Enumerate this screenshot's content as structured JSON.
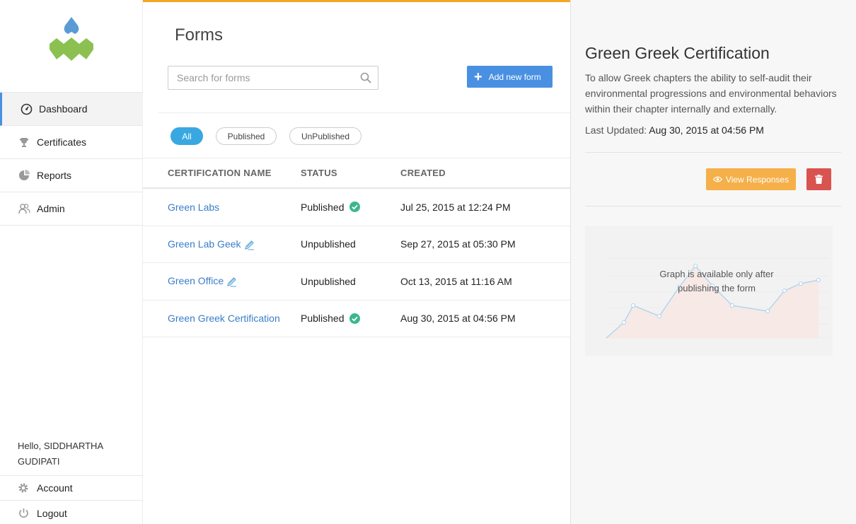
{
  "sidebar": {
    "nav": [
      {
        "label": "Dashboard",
        "icon": "dashboard-icon",
        "active": true
      },
      {
        "label": "Certificates",
        "icon": "trophy-icon",
        "active": false
      },
      {
        "label": "Reports",
        "icon": "pie-chart-icon",
        "active": false
      },
      {
        "label": "Admin",
        "icon": "users-icon",
        "active": false
      }
    ],
    "greeting": "Hello, SIDDHARTHA GUDIPATI",
    "bottom": [
      {
        "label": "Account",
        "icon": "gear-icon"
      },
      {
        "label": "Logout",
        "icon": "power-icon"
      }
    ]
  },
  "main": {
    "title": "Forms",
    "search_placeholder": "Search for forms",
    "add_button": "Add new form",
    "filters": [
      "All",
      "Published",
      "UnPublished"
    ],
    "columns": [
      "CERTIFICATION NAME",
      "STATUS",
      "CREATED"
    ],
    "rows": [
      {
        "name": "Green Labs",
        "status": "Published",
        "created": "Jul 25, 2015 at 12:24 PM"
      },
      {
        "name": "Green Lab Geek",
        "status": "Unpublished",
        "created": "Sep 27, 2015 at 05:30 PM"
      },
      {
        "name": "Green Office",
        "status": "Unpublished",
        "created": "Oct 13, 2015 at 11:16 AM"
      },
      {
        "name": "Green Greek Certification",
        "status": "Published",
        "created": "Aug 30, 2015 at 04:56 PM"
      }
    ]
  },
  "panel": {
    "title": "Green Greek Certification",
    "description": "To allow Greek chapters the ability to self-audit their environmental progressions and environmental behaviors within their chapter internally and externally.",
    "updated_label": "Last Updated:",
    "updated_value": "Aug 30, 2015 at 04:56 PM",
    "view_button": "View Responses",
    "graph_message": "Graph is available only after publishing the form"
  },
  "colors": {
    "accent": "#4a90e2",
    "top_bar": "#f5a623",
    "published_check": "#3bb88e",
    "view_button": "#f5b04a",
    "delete_button": "#d9534f",
    "filter_active": "#3aa8e0"
  }
}
